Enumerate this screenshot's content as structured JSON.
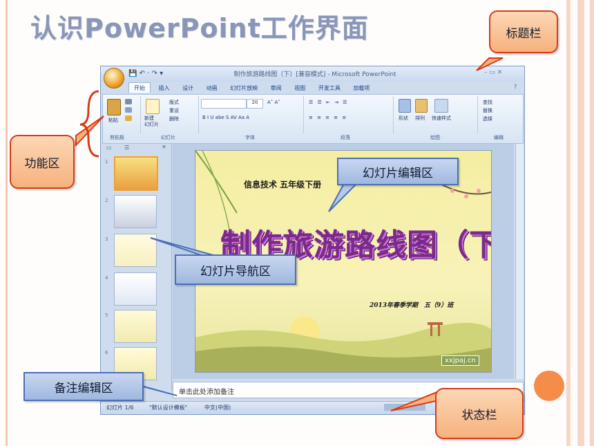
{
  "page": {
    "title": "认识PowerPoint工作界面"
  },
  "window": {
    "title": "制作旅游路线图（下）[兼容模式] - Microsoft PowerPoint",
    "qat": "💾 ↶ · ↷ ▾",
    "controls": "–  ▭  ✕",
    "tabs": [
      "开始",
      "插入",
      "设计",
      "动画",
      "幻灯片放映",
      "审阅",
      "视图",
      "开发工具",
      "加载项"
    ],
    "help": "?"
  },
  "ribbon": {
    "paste": "粘贴",
    "new_slide": "新建\n幻灯片",
    "layout": "版式",
    "reset": "重设",
    "delete": "删除",
    "font_size": "20",
    "font_buttons": "B  I  U  abe  S  AV  Aa  A",
    "shapes": "形状",
    "arrange": "排列",
    "quick_styles": "快速样式",
    "find": "查找",
    "replace": "替换",
    "select": "选择",
    "groups": [
      "剪贴板",
      "幻灯片",
      "字体",
      "段落",
      "绘图",
      "编辑"
    ]
  },
  "panel": {
    "thumb_numbers": [
      "1",
      "2",
      "3",
      "4",
      "5",
      "6"
    ]
  },
  "slide": {
    "subtitle": "信息技术 五年级下册",
    "headline": "制作旅游路线图（下）",
    "footer": "2013年春季学期　五（9）班",
    "watermark": "xxjpaj.cn"
  },
  "notes": {
    "placeholder": "单击此处添加备注"
  },
  "status": {
    "slide": "幻灯片 1/6",
    "theme": "\"默认设计模板\"",
    "lang": "中文(中国)"
  },
  "callouts": {
    "title_bar": "标题栏",
    "ribbon_area": "功能区",
    "slide_edit": "幻灯片编辑区",
    "slide_nav": "幻灯片导航区",
    "notes_edit": "备注编辑区",
    "status_bar": "状态栏"
  },
  "colors": {
    "accent": "#f58c4a",
    "callout_blue": "#4a6fb5",
    "callout_red": "#d63b1a"
  }
}
